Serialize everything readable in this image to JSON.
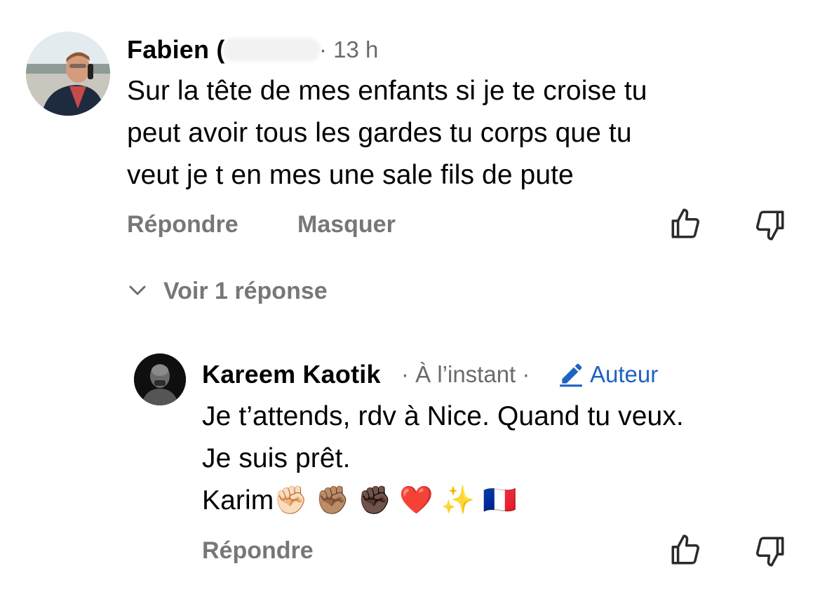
{
  "comments": [
    {
      "author": "Fabien (",
      "time": "· 13 h",
      "lines": [
        "Sur la tête de mes enfants  si je te croise tu",
        "peut avoir tous les gardes tu corps que tu",
        "veut je t en mes une sale fils de pute"
      ],
      "actions": {
        "reply": "Répondre",
        "hide": "Masquer"
      },
      "icons": {
        "like": "thumbs-up-icon",
        "dislike": "thumbs-down-icon"
      }
    }
  ],
  "replies_toggle": {
    "label": "Voir 1 réponse",
    "icon": "chevron-down-icon"
  },
  "reply": {
    "author": "Kareem Kaotik",
    "time": "· À l’instant ·",
    "badge": {
      "label": "Auteur",
      "icon": "pencil-icon",
      "color": "#1f63c2"
    },
    "lines": [
      "Je t’attends, rdv à Nice. Quand tu veux.",
      "Je suis prêt.",
      "Karim✊🏻 ✊🏽 ✊🏿 ❤️ ✨ 🇫🇷"
    ],
    "actions": {
      "reply": "Répondre"
    },
    "icons": {
      "like": "thumbs-up-icon",
      "dislike": "thumbs-down-icon"
    }
  }
}
